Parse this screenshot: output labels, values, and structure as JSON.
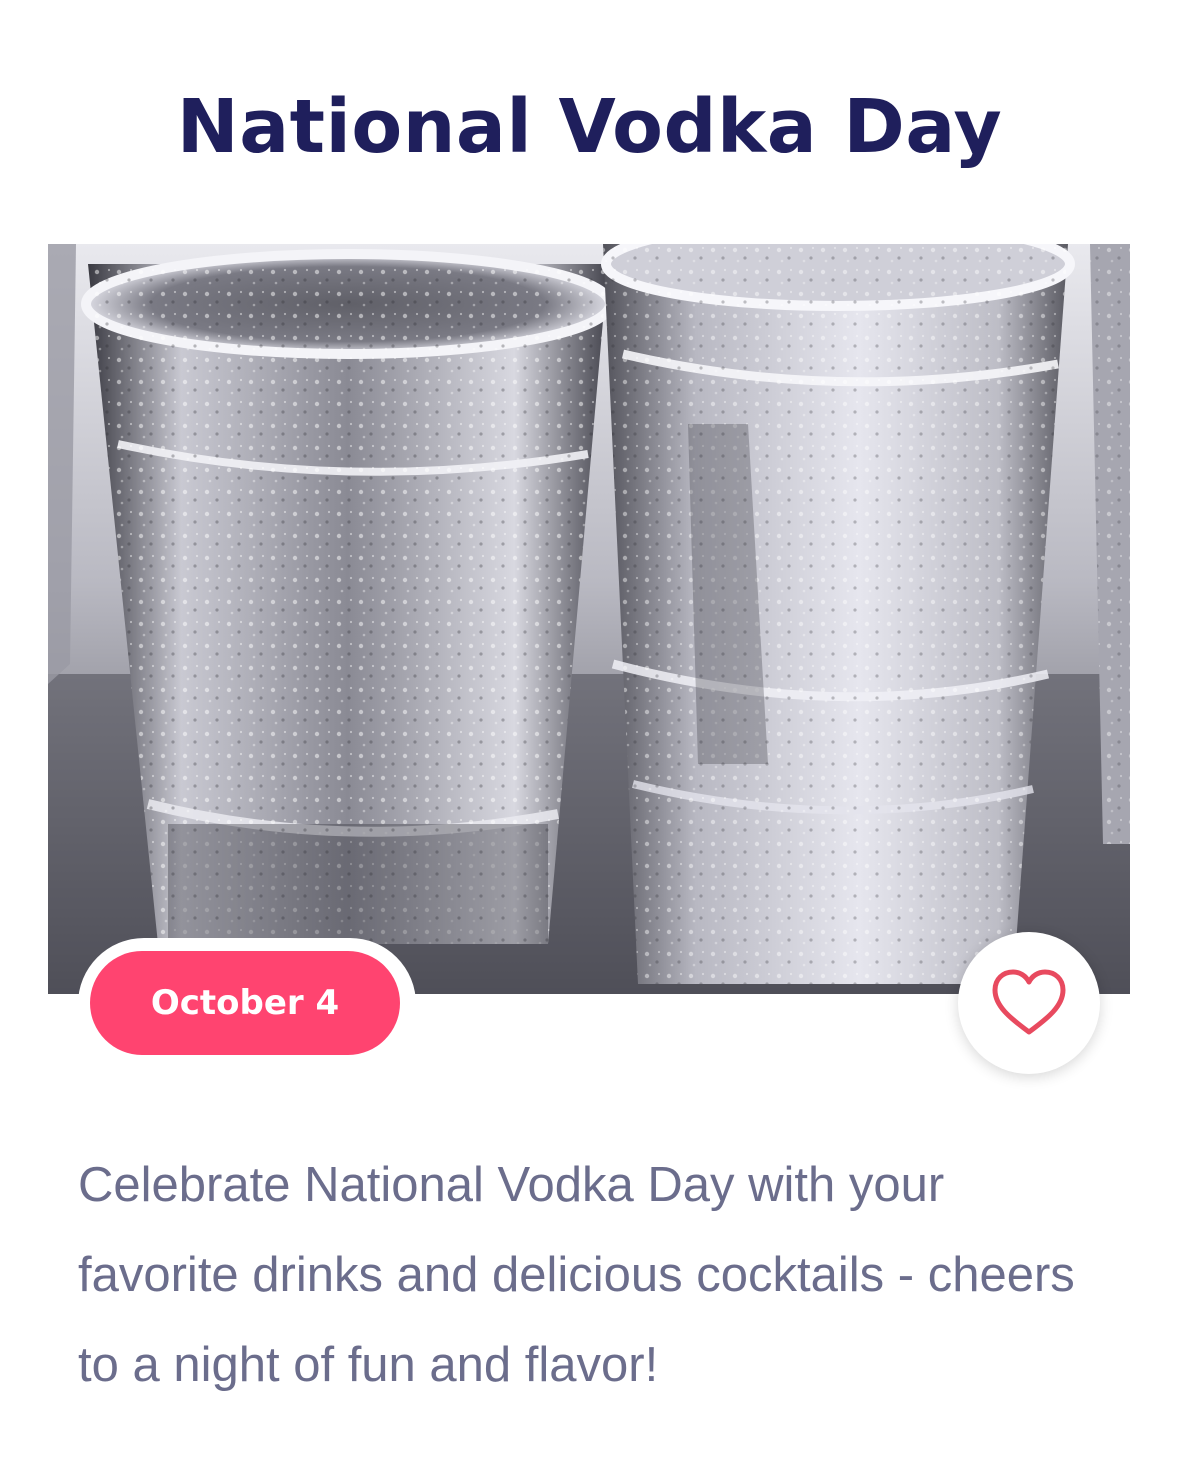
{
  "event": {
    "title": "National Vodka Day",
    "date_label": "October 4",
    "description": "Celebrate National Vodka Day with your favorite drinks and delicious cocktails - cheers to a night of fun and flavor!"
  },
  "favorite": {
    "icon": "heart-outline-icon",
    "selected": false
  },
  "colors": {
    "title": "#1f1f5c",
    "badge": "#ff4470",
    "heart": "#e84a5f",
    "body_text": "#6b6d8c"
  }
}
